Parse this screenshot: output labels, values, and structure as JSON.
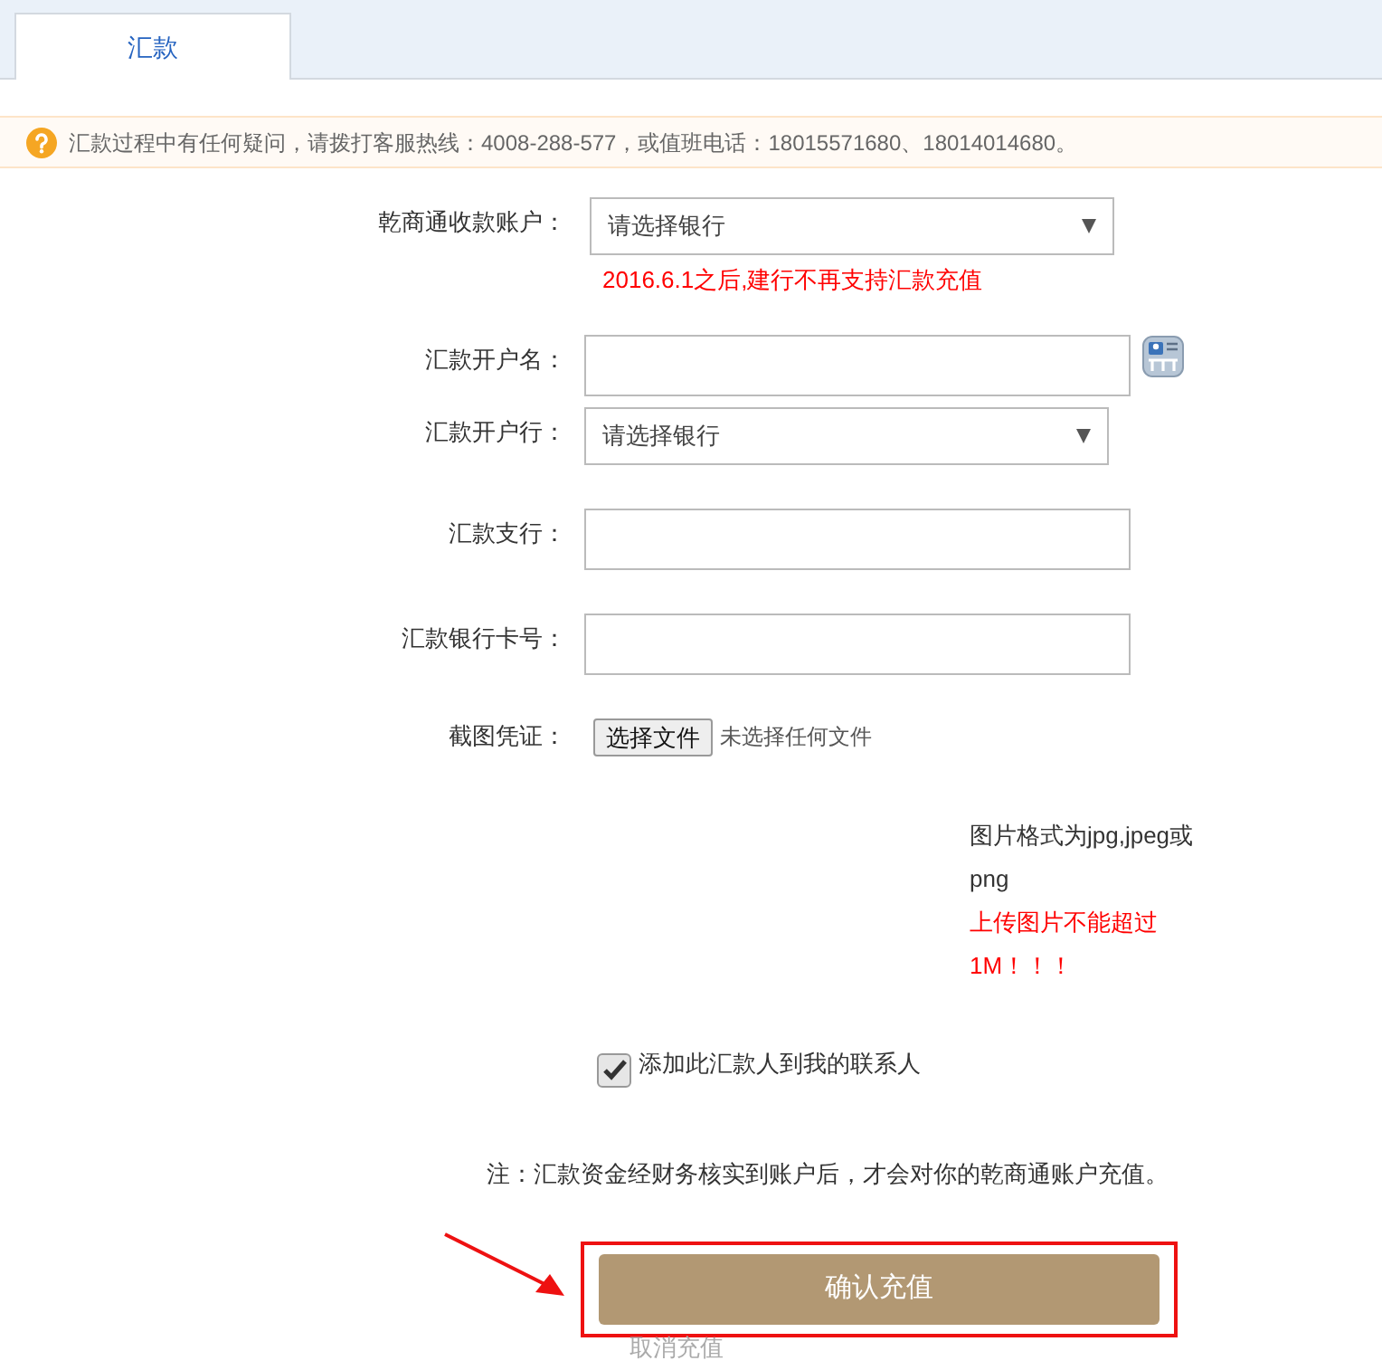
{
  "tabs": [
    {
      "label": "汇款",
      "selected": true
    }
  ],
  "notice": {
    "text": "汇款过程中有任何疑问，请拨打客服热线：4008-288-577，或值班电话：18015571680、18014014680。"
  },
  "form": {
    "rows": [
      {
        "kind": "select",
        "label": "乾商通收款账户：",
        "value": "请选择银行",
        "warning": "2016.6.1之后,建行不再支持汇款充值"
      },
      {
        "kind": "text",
        "label": "汇款开户名：",
        "contacts": true
      },
      {
        "kind": "select",
        "label": "汇款开户行：",
        "value": "请选择银行"
      },
      {
        "kind": "text",
        "label": "汇款支行："
      },
      {
        "kind": "text",
        "label": "汇款银行卡号："
      },
      {
        "kind": "file",
        "label": "截图凭证：",
        "button": "选择文件",
        "status": "未选择任何文件"
      }
    ],
    "hint": "图片格式为jpg,jpeg或png",
    "limit": "上传图片不能超过1M！！！",
    "checkbox": {
      "label": "添加此汇款人到我的联系人",
      "checked": true
    },
    "note": "注：汇款资金经财务核实到账户后，才会对你的乾商通账户充值。",
    "submit": "确认充值",
    "cancel": "取消充值"
  }
}
